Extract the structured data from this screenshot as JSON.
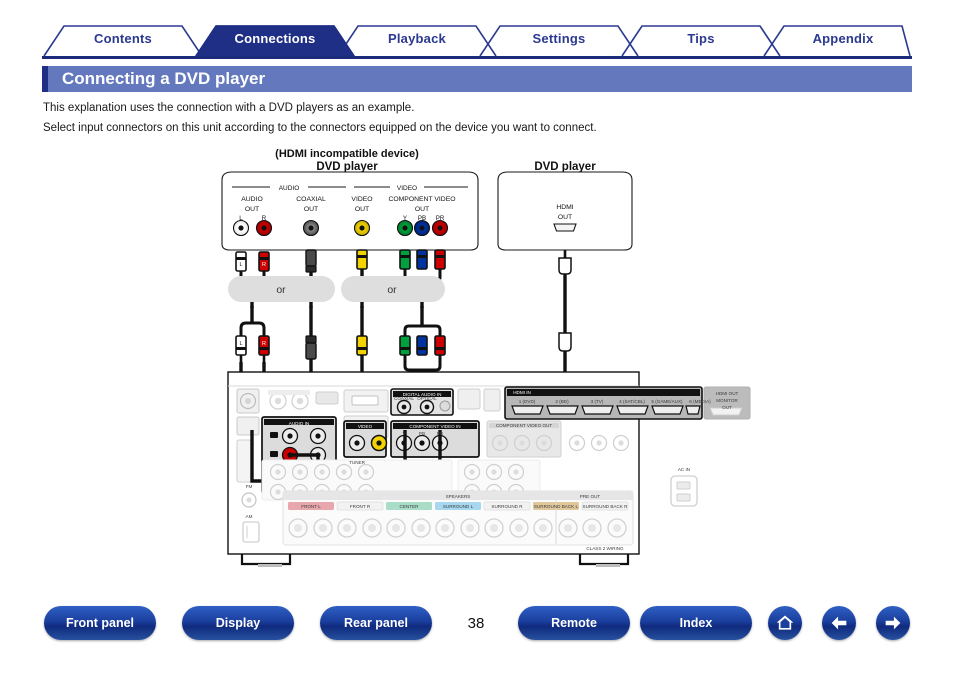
{
  "tabs": [
    {
      "label": "Contents",
      "active": false
    },
    {
      "label": "Connections",
      "active": true
    },
    {
      "label": "Playback",
      "active": false
    },
    {
      "label": "Settings",
      "active": false
    },
    {
      "label": "Tips",
      "active": false
    },
    {
      "label": "Appendix",
      "active": false
    }
  ],
  "page": {
    "title": "Connecting a DVD player",
    "intro_line1": "This explanation uses the connection with a DVD players as an example.",
    "intro_line2": "Select input connectors on this unit according to the connectors equipped on the device you want to connect.",
    "number": "38"
  },
  "diagram": {
    "left_device": {
      "caption_top": "(HDMI incompatible device)",
      "caption_main": "DVD player",
      "group_audio": "AUDIO",
      "group_video": "VIDEO",
      "jacks": {
        "audio_out_l1": "AUDIO",
        "audio_out_l2": "OUT",
        "audio_L": "L",
        "audio_R": "R",
        "coaxial_l1": "COAXIAL",
        "coaxial_l2": "OUT",
        "video_l1": "VIDEO",
        "video_l2": "OUT",
        "component_l1": "COMPONENT VIDEO",
        "component_l2": "OUT",
        "comp_y": "Y",
        "comp_pb": "PB",
        "comp_pr": "PR"
      }
    },
    "right_device": {
      "caption_main": "DVD player",
      "hdmi_l1": "HDMI",
      "hdmi_l2": "OUT"
    },
    "or_label_audio": "or",
    "or_label_video": "or",
    "receiver": {
      "hdmi_bank_label": "HDMI IN",
      "hdmi_ports": [
        "1 (DVD)",
        "2 (BD)",
        "3 (TV)",
        "4 (SAT/CBL)",
        "5 (GAME/AUX)",
        "6 (MEDIA)"
      ],
      "hdmi_out_l1": "HDMI OUT",
      "hdmi_out_l2": "MONITOR",
      "hdmi_out_l3": "OUT",
      "component_in_label": "COMPONENT VIDEO IN",
      "component_out_label": "COMPONENT VIDEO OUT",
      "comp_y": "Y",
      "comp_pb": "PB",
      "comp_pr": "PR",
      "audio_in_label": "AUDIO IN",
      "digital_audio_label": "DIGITAL AUDIO IN",
      "coaxial_label": "COAXIAL",
      "optical_label": "OPTICAL",
      "video_label": "VIDEO",
      "monitor_out_label": "MONITOR OUT",
      "preout_label": "PRE OUT",
      "tuner_label": "TUNER",
      "ac_in_label": "AC IN",
      "antenna_fm": "FM",
      "antenna_am": "AM",
      "speakers_label": "SPEAKERS",
      "speaker_terminals": [
        {
          "label": "FRONT L",
          "color": "#e8a7ad"
        },
        {
          "label": "FRONT R",
          "color": "#f2f2f2"
        },
        {
          "label": "CENTER",
          "color": "#a9ddc8"
        },
        {
          "label": "SURROUND L",
          "color": "#a8d8ef"
        },
        {
          "label": "SURROUND R",
          "color": "#f2f2f2"
        },
        {
          "label": "SURROUND BACK L",
          "color": "#e0c79a"
        },
        {
          "label": "SURROUND BACK R",
          "color": "#f2f2f2"
        }
      ],
      "class_label": "CLASS 2 WIRING",
      "polarity_plus": "+",
      "polarity_minus": "−"
    }
  },
  "bottom_nav": {
    "buttons": [
      {
        "label": "Front panel"
      },
      {
        "label": "Display"
      },
      {
        "label": "Rear panel"
      },
      {
        "label": "Remote"
      },
      {
        "label": "Index"
      }
    ],
    "icons": [
      {
        "name": "home-icon"
      },
      {
        "name": "arrow-left-icon"
      },
      {
        "name": "arrow-right-icon"
      }
    ]
  },
  "colors": {
    "tab_active_bg": "#1f2f86",
    "tab_text": "#2b3990",
    "title_bar": "#6478be",
    "title_accent": "#1f2f86",
    "pill": "#1b3f9e",
    "jack_red": "#cc0000",
    "jack_white": "#ffffff",
    "jack_yellow": "#f2d200",
    "jack_green": "#00a03c",
    "jack_blue": "#0033a0",
    "jack_black": "#3a3a3a"
  }
}
